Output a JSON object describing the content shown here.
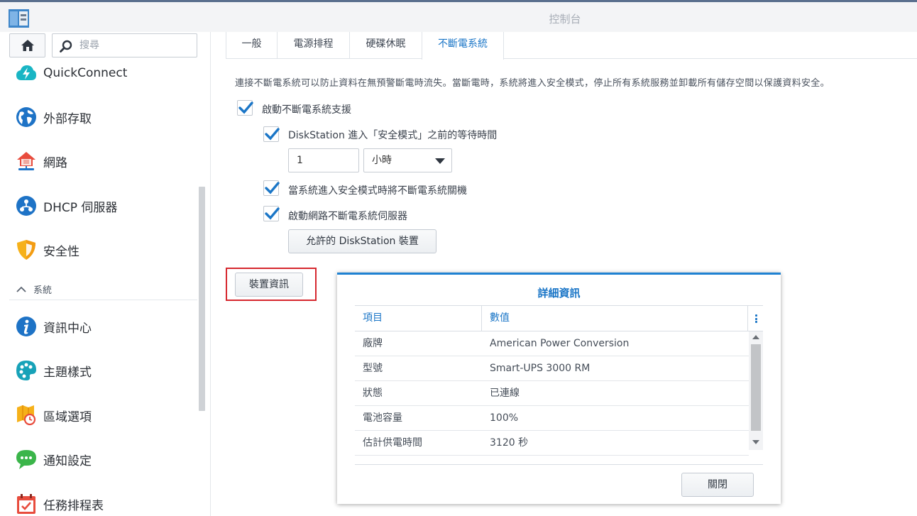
{
  "window": {
    "title": "控制台"
  },
  "sidebar": {
    "search_placeholder": "搜尋",
    "items": [
      {
        "label": "QuickConnect",
        "icon": "quickconnect-icon"
      },
      {
        "label": "外部存取",
        "icon": "globe-icon"
      },
      {
        "label": "網路",
        "icon": "network-house-icon"
      },
      {
        "label": "DHCP 伺服器",
        "icon": "dhcp-icon"
      },
      {
        "label": "安全性",
        "icon": "shield-icon"
      }
    ],
    "section": {
      "label": "系統",
      "icon": "chevron-up-icon"
    },
    "system_items": [
      {
        "label": "資訊中心",
        "icon": "info-icon"
      },
      {
        "label": "主題樣式",
        "icon": "palette-icon"
      },
      {
        "label": "區域選項",
        "icon": "map-clock-icon"
      },
      {
        "label": "通知設定",
        "icon": "chat-bubble-icon"
      },
      {
        "label": "任務排程表",
        "icon": "calendar-check-icon"
      }
    ]
  },
  "tabs": [
    {
      "label": "一般",
      "active": false
    },
    {
      "label": "電源排程",
      "active": false
    },
    {
      "label": "硬碟休眠",
      "active": false
    },
    {
      "label": "不斷電系統",
      "active": true
    }
  ],
  "ups": {
    "description": "連接不斷電系統可以防止資料在無預警斷電時流失。當斷電時，系統將進入安全模式，停止所有系統服務並卸載所有儲存空間以保護資料安全。",
    "enable_label": "啟動不斷電系統支援",
    "wait_label": "DiskStation 進入「安全模式」之前的等待時間",
    "wait_value": "1",
    "wait_unit": "小時",
    "shutdown_label": "當系統進入安全模式時將不斷電系統關機",
    "network_server_label": "啟動網路不斷電系統伺服器",
    "permitted_button": "允許的 DiskStation 裝置",
    "device_info_button": "裝置資訊"
  },
  "dialog": {
    "title": "詳細資訊",
    "col_item": "項目",
    "col_value": "數值",
    "rows": [
      {
        "k": "廠牌",
        "v": "American Power Conversion"
      },
      {
        "k": "型號",
        "v": "Smart-UPS 3000 RM"
      },
      {
        "k": "狀態",
        "v": "已連線"
      },
      {
        "k": "電池容量",
        "v": "100%"
      },
      {
        "k": "估計供電時間",
        "v": "3120 秒"
      }
    ],
    "close_button": "關閉"
  },
  "colors": {
    "accent": "#1b76c7",
    "highlight": "#d6282f"
  }
}
